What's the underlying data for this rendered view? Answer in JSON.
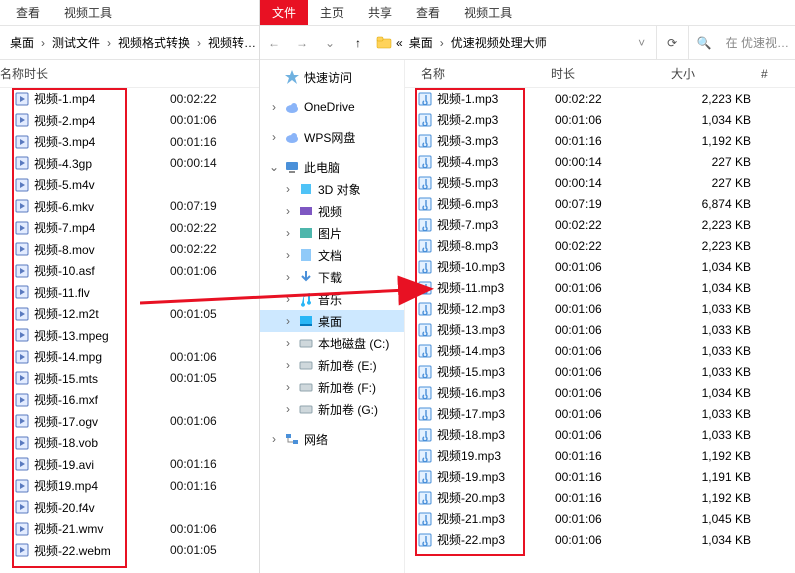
{
  "left": {
    "tabs": {
      "view": "查看",
      "videoTools": "视频工具"
    },
    "breadcrumb": [
      "桌面",
      "测试文件",
      "视频格式转换",
      "视频转…"
    ],
    "cols": {
      "name": "名称",
      "dur": "时长"
    },
    "files": [
      {
        "n": "视频-1.mp4",
        "d": "00:02:22"
      },
      {
        "n": "视频-2.mp4",
        "d": "00:01:06"
      },
      {
        "n": "视频-3.mp4",
        "d": "00:01:16"
      },
      {
        "n": "视频-4.3gp",
        "d": "00:00:14"
      },
      {
        "n": "视频-5.m4v",
        "d": ""
      },
      {
        "n": "视频-6.mkv",
        "d": "00:07:19"
      },
      {
        "n": "视频-7.mp4",
        "d": "00:02:22"
      },
      {
        "n": "视频-8.mov",
        "d": "00:02:22"
      },
      {
        "n": "视频-10.asf",
        "d": "00:01:06"
      },
      {
        "n": "视频-11.flv",
        "d": ""
      },
      {
        "n": "视频-12.m2t",
        "d": "00:01:05"
      },
      {
        "n": "视频-13.mpeg",
        "d": ""
      },
      {
        "n": "视频-14.mpg",
        "d": "00:01:06"
      },
      {
        "n": "视频-15.mts",
        "d": "00:01:05"
      },
      {
        "n": "视频-16.mxf",
        "d": ""
      },
      {
        "n": "视频-17.ogv",
        "d": "00:01:06"
      },
      {
        "n": "视频-18.vob",
        "d": ""
      },
      {
        "n": "视频-19.avi",
        "d": "00:01:16"
      },
      {
        "n": "视频19.mp4",
        "d": "00:01:16"
      },
      {
        "n": "视频-20.f4v",
        "d": ""
      },
      {
        "n": "视频-21.wmv",
        "d": "00:01:06"
      },
      {
        "n": "视频-22.webm",
        "d": "00:01:05"
      }
    ]
  },
  "right": {
    "tabs": {
      "file": "文件",
      "home": "主页",
      "share": "共享",
      "view": "查看",
      "videoTools": "视频工具"
    },
    "breadcrumb_prefix": "«",
    "breadcrumb": [
      "桌面",
      "优速视频处理大师"
    ],
    "search_placeholder": "在 优速视…",
    "cols": {
      "name": "名称",
      "dur": "时长",
      "size": "大小",
      "hash": "#"
    },
    "tree": [
      {
        "tw": "",
        "icon": "star",
        "label": "快速访问",
        "indent": 0
      },
      {
        "tw": ">",
        "icon": "cloud",
        "label": "OneDrive",
        "indent": 0
      },
      {
        "tw": ">",
        "icon": "cloud",
        "label": "WPS网盘",
        "indent": 0
      },
      {
        "tw": "v",
        "icon": "pc",
        "label": "此电脑",
        "indent": 0
      },
      {
        "tw": ">",
        "icon": "obj3d",
        "label": "3D 对象",
        "indent": 1
      },
      {
        "tw": ">",
        "icon": "video",
        "label": "视频",
        "indent": 1
      },
      {
        "tw": ">",
        "icon": "pic",
        "label": "图片",
        "indent": 1
      },
      {
        "tw": ">",
        "icon": "doc",
        "label": "文档",
        "indent": 1
      },
      {
        "tw": ">",
        "icon": "down",
        "label": "下载",
        "indent": 1
      },
      {
        "tw": ">",
        "icon": "music",
        "label": "音乐",
        "indent": 1
      },
      {
        "tw": ">",
        "icon": "desk",
        "label": "桌面",
        "indent": 1,
        "sel": true
      },
      {
        "tw": ">",
        "icon": "drive",
        "label": "本地磁盘 (C:)",
        "indent": 1
      },
      {
        "tw": ">",
        "icon": "drive",
        "label": "新加卷 (E:)",
        "indent": 1
      },
      {
        "tw": ">",
        "icon": "drive",
        "label": "新加卷 (F:)",
        "indent": 1
      },
      {
        "tw": ">",
        "icon": "drive",
        "label": "新加卷 (G:)",
        "indent": 1
      },
      {
        "tw": ">",
        "icon": "net",
        "label": "网络",
        "indent": 0
      }
    ],
    "files": [
      {
        "n": "视频-1.mp3",
        "d": "00:02:22",
        "s": "2,223 KB"
      },
      {
        "n": "视频-2.mp3",
        "d": "00:01:06",
        "s": "1,034 KB"
      },
      {
        "n": "视频-3.mp3",
        "d": "00:01:16",
        "s": "1,192 KB"
      },
      {
        "n": "视频-4.mp3",
        "d": "00:00:14",
        "s": "227 KB"
      },
      {
        "n": "视频-5.mp3",
        "d": "00:00:14",
        "s": "227 KB"
      },
      {
        "n": "视频-6.mp3",
        "d": "00:07:19",
        "s": "6,874 KB"
      },
      {
        "n": "视频-7.mp3",
        "d": "00:02:22",
        "s": "2,223 KB"
      },
      {
        "n": "视频-8.mp3",
        "d": "00:02:22",
        "s": "2,223 KB"
      },
      {
        "n": "视频-10.mp3",
        "d": "00:01:06",
        "s": "1,034 KB"
      },
      {
        "n": "视频-11.mp3",
        "d": "00:01:06",
        "s": "1,034 KB"
      },
      {
        "n": "视频-12.mp3",
        "d": "00:01:06",
        "s": "1,033 KB"
      },
      {
        "n": "视频-13.mp3",
        "d": "00:01:06",
        "s": "1,033 KB"
      },
      {
        "n": "视频-14.mp3",
        "d": "00:01:06",
        "s": "1,033 KB"
      },
      {
        "n": "视频-15.mp3",
        "d": "00:01:06",
        "s": "1,033 KB"
      },
      {
        "n": "视频-16.mp3",
        "d": "00:01:06",
        "s": "1,034 KB"
      },
      {
        "n": "视频-17.mp3",
        "d": "00:01:06",
        "s": "1,033 KB"
      },
      {
        "n": "视频-18.mp3",
        "d": "00:01:06",
        "s": "1,033 KB"
      },
      {
        "n": "视频19.mp3",
        "d": "00:01:16",
        "s": "1,192 KB"
      },
      {
        "n": "视频-19.mp3",
        "d": "00:01:16",
        "s": "1,191 KB"
      },
      {
        "n": "视频-20.mp3",
        "d": "00:01:16",
        "s": "1,192 KB"
      },
      {
        "n": "视频-21.mp3",
        "d": "00:01:06",
        "s": "1,045 KB"
      },
      {
        "n": "视频-22.mp3",
        "d": "00:01:06",
        "s": "1,034 KB"
      }
    ]
  },
  "icons": {
    "chev_right": "›",
    "chev_down": "⌄",
    "back": "←",
    "fwd": "→",
    "up": "↑",
    "refresh": "⟳",
    "search": "🔍",
    "dropdown": "˅"
  }
}
